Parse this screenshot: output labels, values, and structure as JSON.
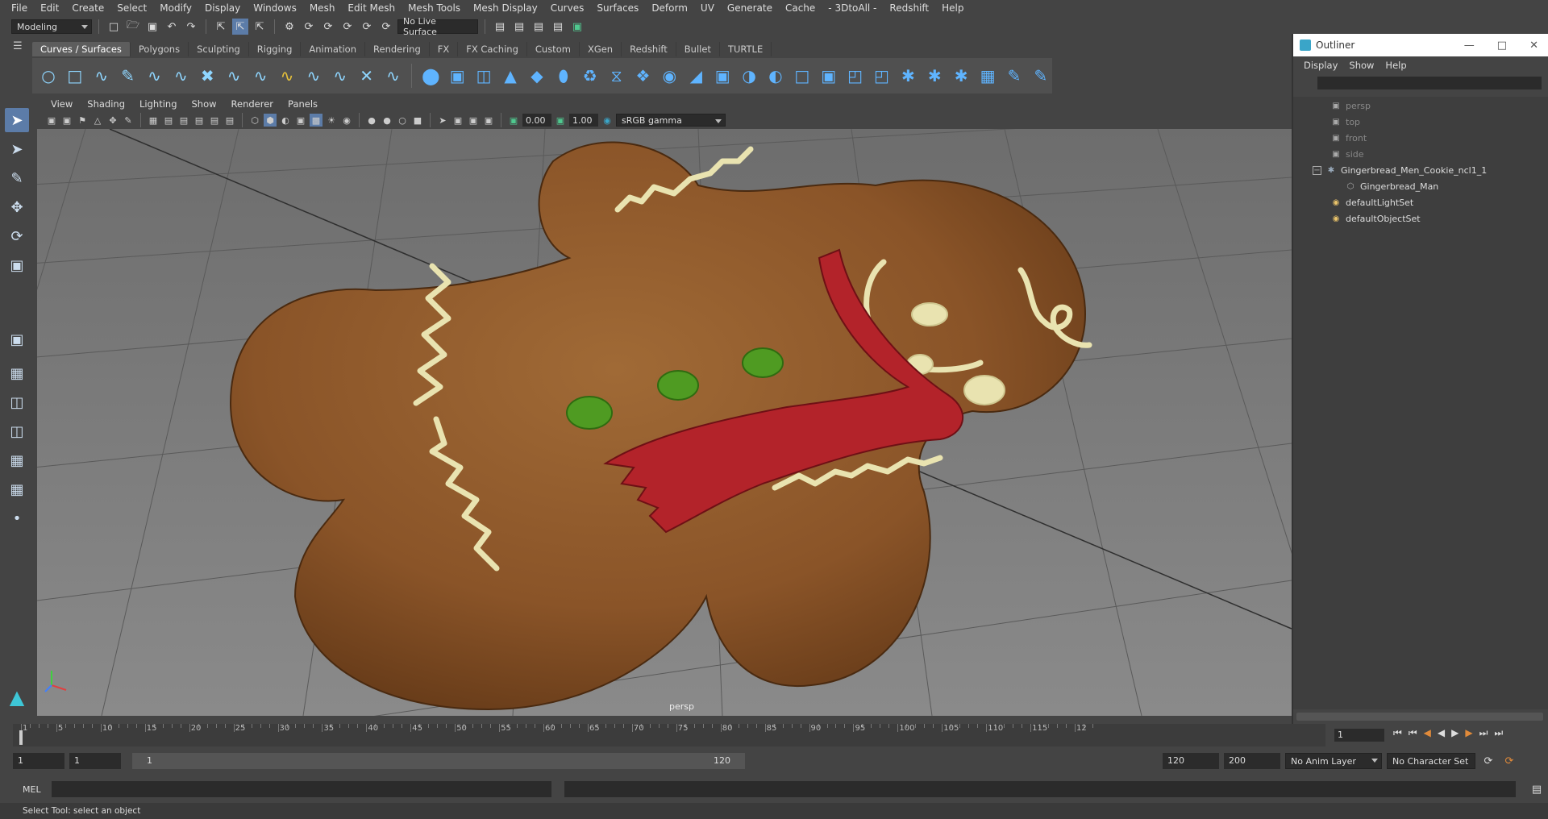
{
  "menus": [
    "File",
    "Edit",
    "Create",
    "Select",
    "Modify",
    "Display",
    "Windows",
    "Mesh",
    "Edit Mesh",
    "Mesh Tools",
    "Mesh Display",
    "Curves",
    "Surfaces",
    "Deform",
    "UV",
    "Generate",
    "Cache",
    "- 3DtoAll -",
    "Redshift",
    "Help"
  ],
  "status": {
    "mode": "Modeling",
    "live_surface": "No Live Surface"
  },
  "shelf_tabs": [
    "Curves / Surfaces",
    "Polygons",
    "Sculpting",
    "Rigging",
    "Animation",
    "Rendering",
    "FX",
    "FX Caching",
    "Custom",
    "XGen",
    "Redshift",
    "Bullet",
    "TURTLE"
  ],
  "active_shelf_tab": "Curves / Surfaces",
  "viewport": {
    "menus": [
      "View",
      "Shading",
      "Lighting",
      "Show",
      "Renderer",
      "Panels"
    ],
    "exposure": "0.00",
    "gamma": "1.00",
    "colorspace": "sRGB gamma",
    "camera": "persp"
  },
  "outliner": {
    "title": "Outliner",
    "menus": [
      "Display",
      "Show",
      "Help"
    ],
    "items": [
      {
        "label": "persp",
        "dim": true,
        "icon": "camera-icon"
      },
      {
        "label": "top",
        "dim": true,
        "icon": "camera-icon"
      },
      {
        "label": "front",
        "dim": true,
        "icon": "camera-icon"
      },
      {
        "label": "side",
        "dim": true,
        "icon": "camera-icon"
      },
      {
        "label": "Gingerbread_Men_Cookie_ncl1_1",
        "dim": false,
        "icon": "group-icon"
      },
      {
        "label": "Gingerbread_Man",
        "dim": false,
        "icon": "mesh-icon"
      },
      {
        "label": "defaultLightSet",
        "dim": false,
        "icon": "set-icon"
      },
      {
        "label": "defaultObjectSet",
        "dim": false,
        "icon": "set-icon"
      }
    ]
  },
  "timeline": {
    "ticks": [
      "1",
      "5",
      "10",
      "15",
      "20",
      "25",
      "30",
      "35",
      "40",
      "45",
      "50",
      "55",
      "60",
      "65",
      "70",
      "75",
      "80",
      "85",
      "90",
      "95",
      "100",
      "105",
      "110",
      "115",
      "12"
    ],
    "current_frame": "1"
  },
  "range": {
    "start": "1",
    "playback_start": "1",
    "slider_start": "1",
    "slider_end": "120",
    "playback_end": "120",
    "end": "200",
    "anim_layer": "No Anim Layer",
    "character_set": "No Character Set"
  },
  "cmd": {
    "lang": "MEL"
  },
  "help_line": "Select Tool: select an object",
  "colors": {
    "cookie": "#8a5428",
    "icing": "#e9e3b0",
    "scarf": "#b3232a",
    "button": "#4f9b22",
    "grid_bg": "#7a7a7a"
  }
}
